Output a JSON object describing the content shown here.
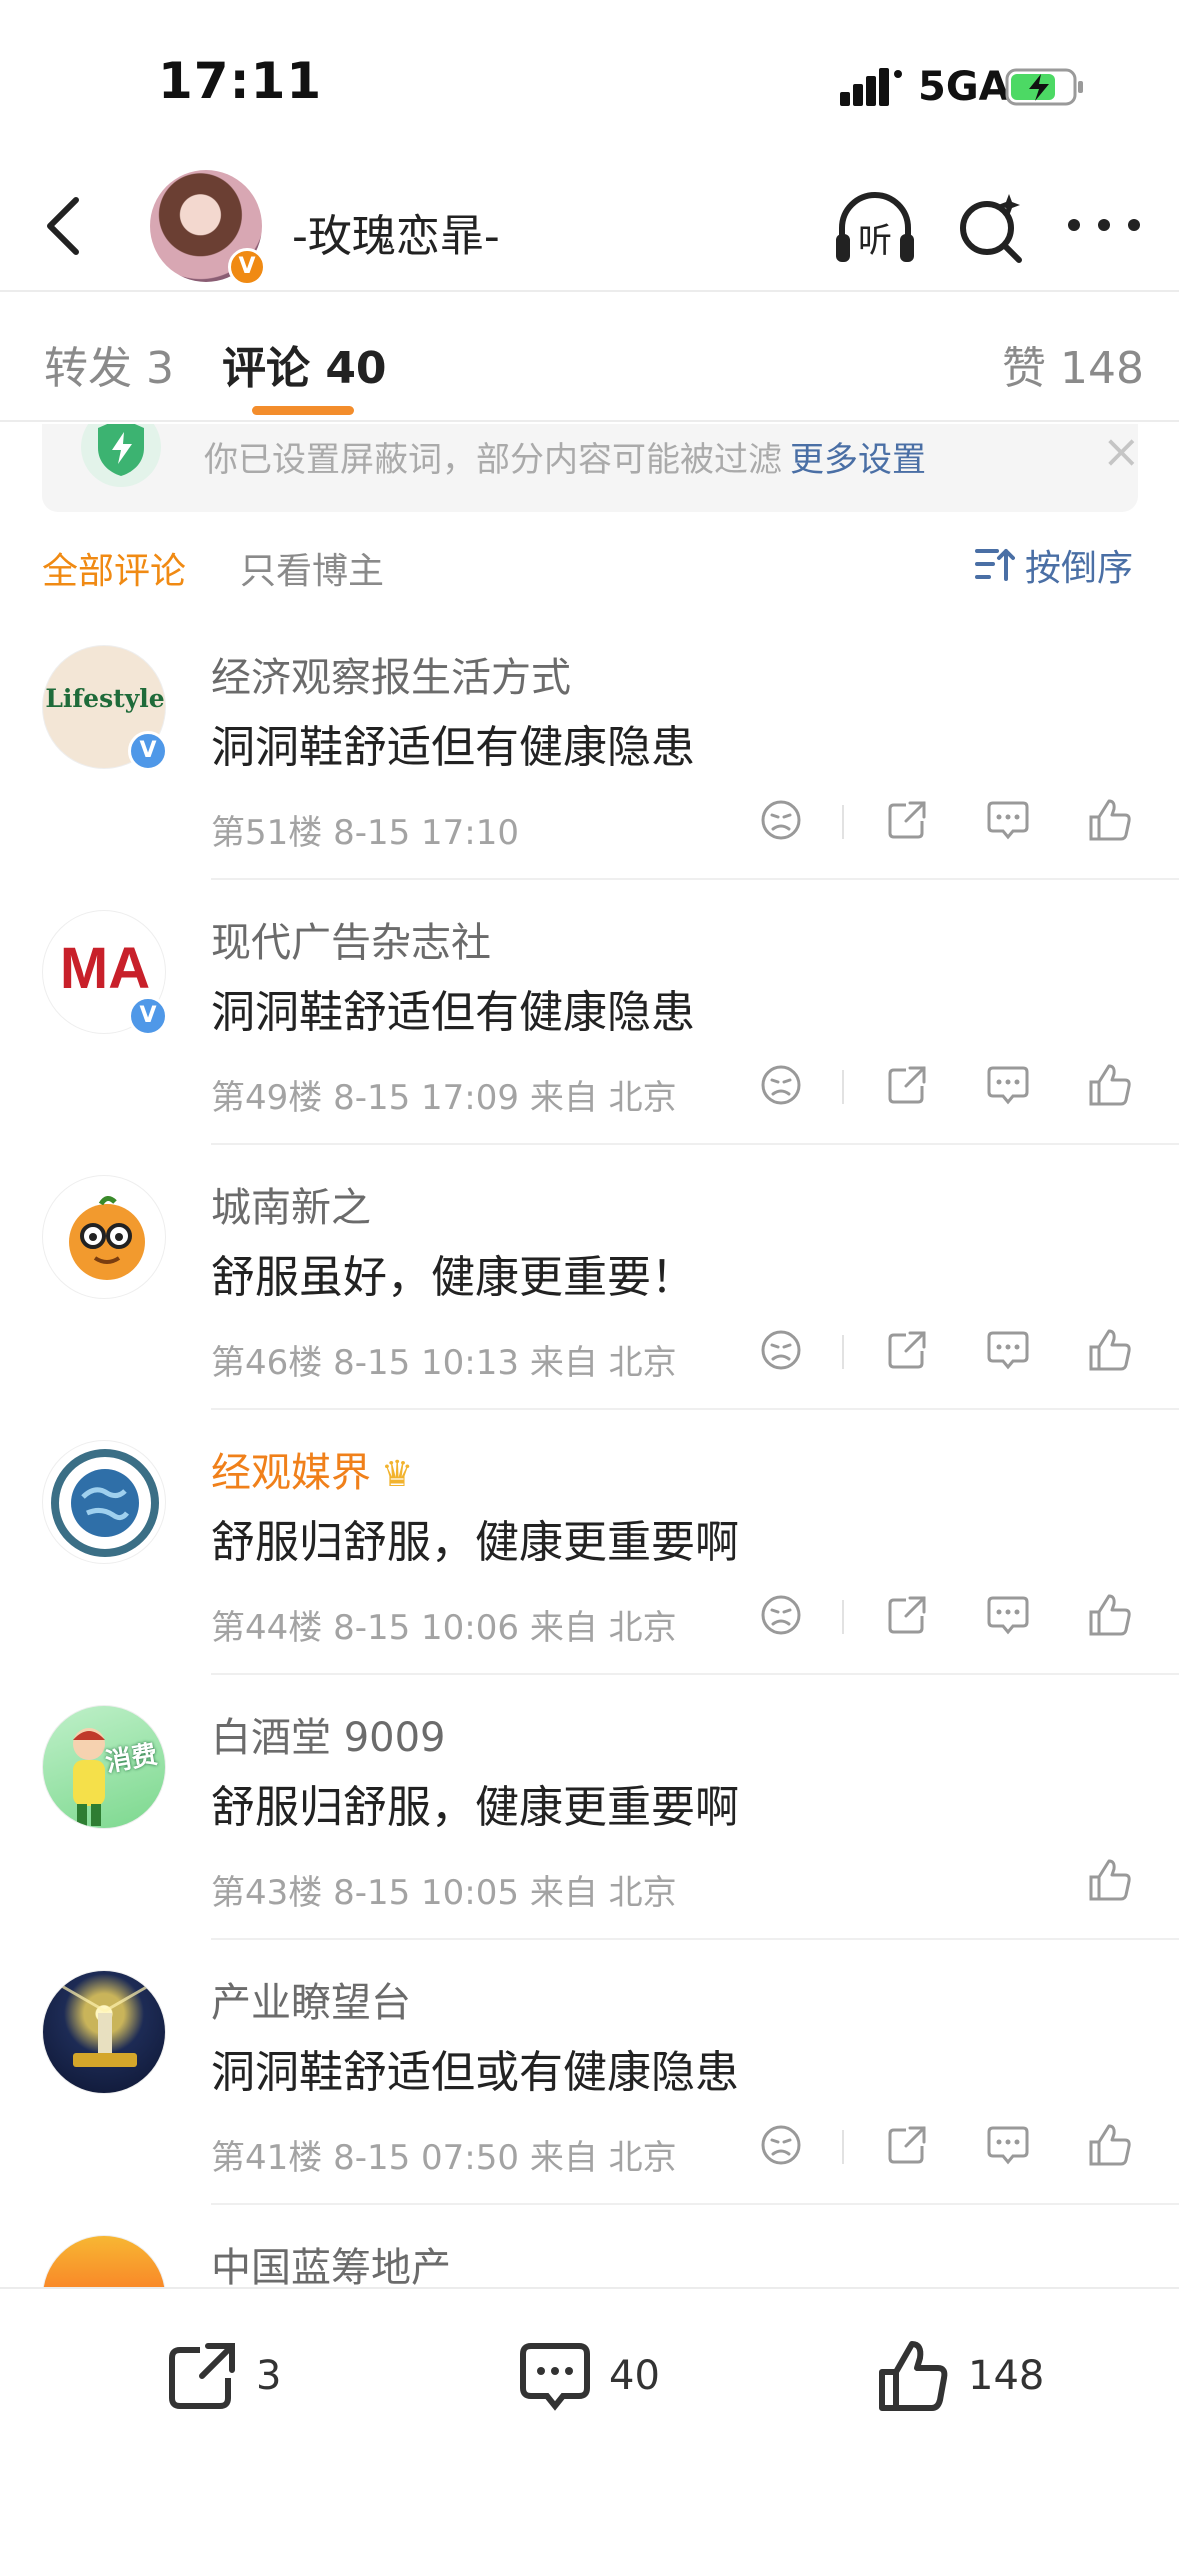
{
  "status_bar": {
    "time": "17:11",
    "network": "5GA"
  },
  "nav": {
    "title": "-玫瑰恋暃-",
    "verified_badge": "V",
    "listen_label": "听"
  },
  "tabs": {
    "repost": "转发 3",
    "comment": "评论 40",
    "likes": "赞 148"
  },
  "notice": {
    "text": "你已设置屏蔽词，部分内容可能被过滤",
    "link": "更多设置",
    "close": "×"
  },
  "filter": {
    "all": "全部评论",
    "owner_only": "只看博主",
    "sort": "按倒序"
  },
  "comments": [
    {
      "name": "经济观察报生活方式",
      "text": "洞洞鞋舒适但有健康隐患",
      "meta": "第51楼 8-15 17:10",
      "avatar_text": "Lifestyle"
    },
    {
      "name": "现代广告杂志社",
      "text": "洞洞鞋舒适但有健康隐患",
      "meta": "第49楼 8-15 17:09 来自 北京",
      "avatar_text": "MA"
    },
    {
      "name": "城南新之",
      "text": "舒服虽好，健康更重要！",
      "meta": "第46楼 8-15 10:13 来自 北京"
    },
    {
      "name": "经观媒界",
      "text": "舒服归舒服，健康更重要啊",
      "meta": "第44楼 8-15 10:06 来自 北京"
    },
    {
      "name": "白酒堂 9009",
      "text": "舒服归舒服，健康更重要啊",
      "meta": "第43楼 8-15 10:05 来自 北京",
      "avatar_text": "消费"
    },
    {
      "name": "产业瞭望台",
      "text": "洞洞鞋舒适但或有健康隐患",
      "meta": "第41楼 8-15 07:50 来自 北京"
    },
    {
      "name": "中国蓝筹地产"
    }
  ],
  "bottom_bar": {
    "share_count": "3",
    "comment_count": "40",
    "like_count": "148"
  },
  "colors": {
    "accent_orange": "#f08a13",
    "link_blue": "#4a6fa5",
    "verified_blue": "#4f98e8"
  }
}
